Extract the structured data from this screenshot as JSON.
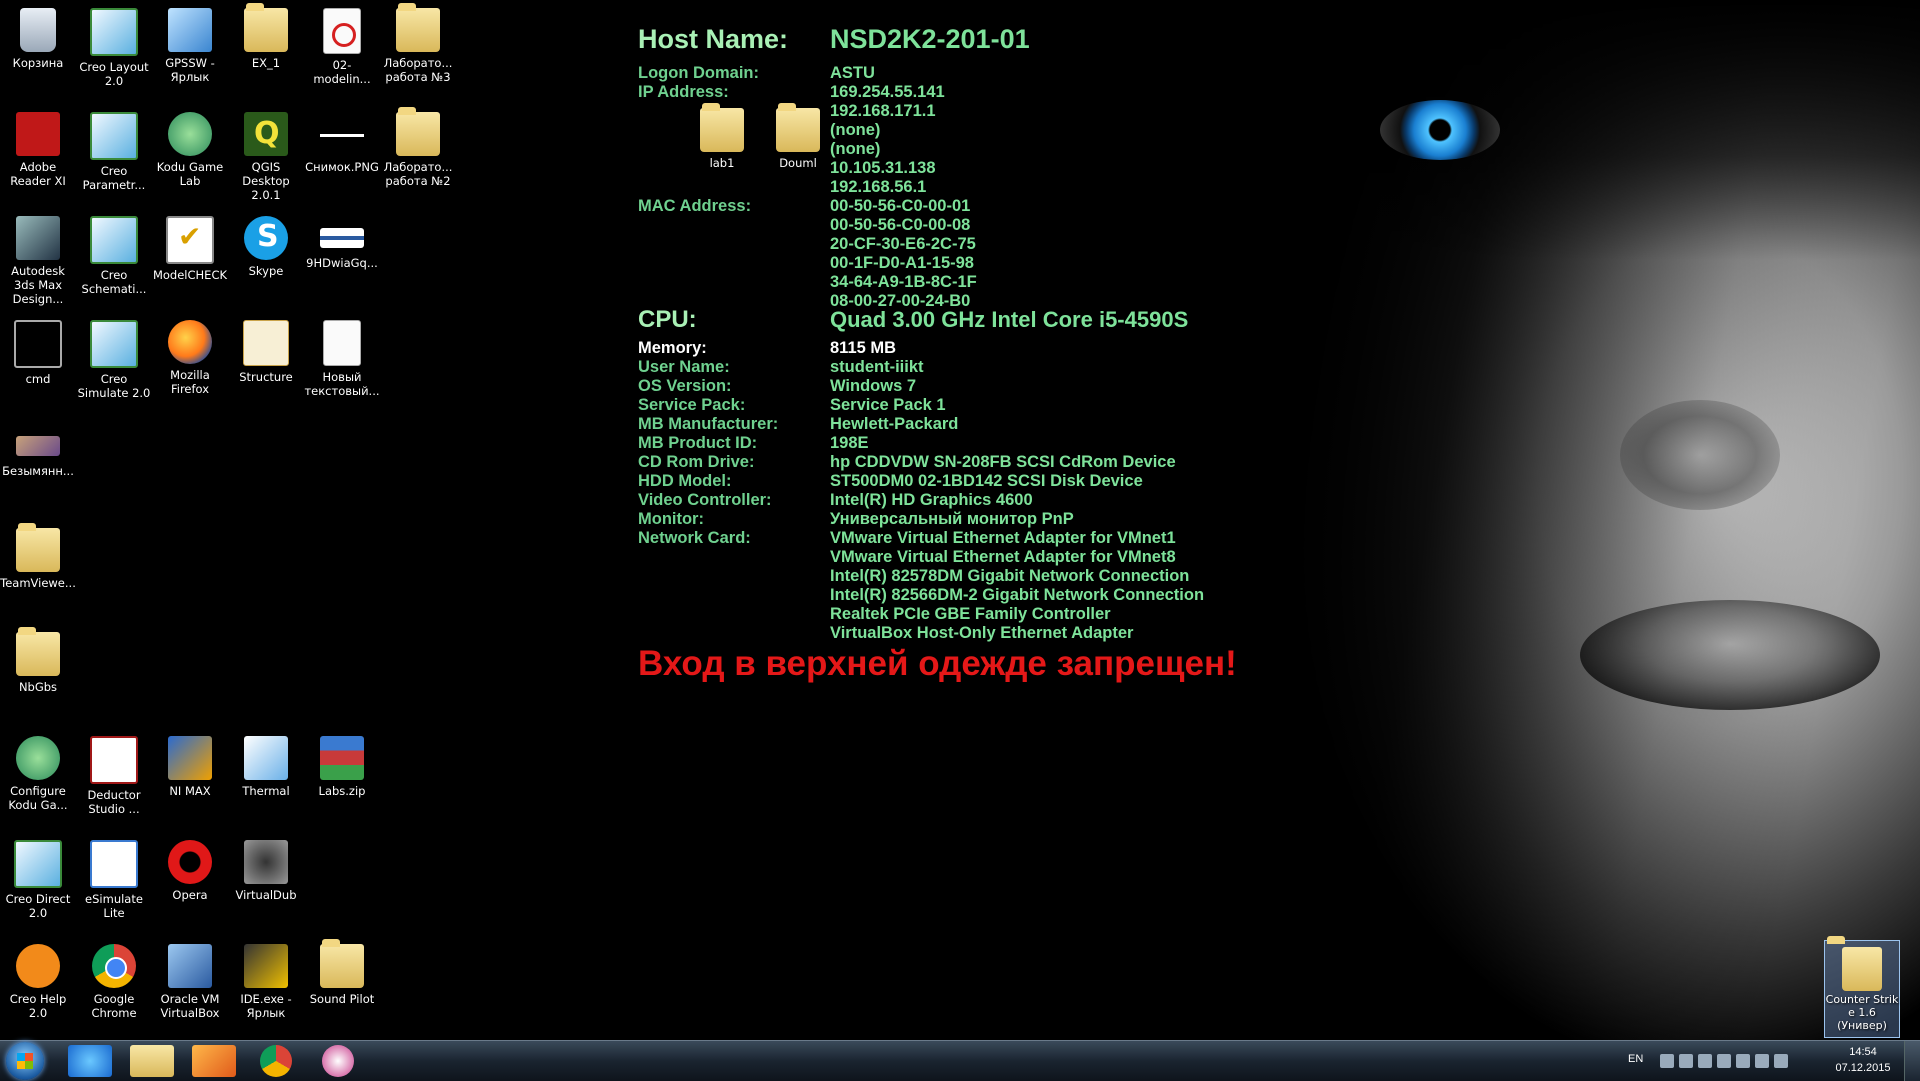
{
  "desktop": {
    "icons": [
      {
        "label": "Корзина",
        "icon": "recycle-bin-icon"
      },
      {
        "label": "Creo Layout 2.0",
        "icon": "creo-layout-icon"
      },
      {
        "label": "GPSSW - Ярлык",
        "icon": "gpssw-icon"
      },
      {
        "label": "EX_1",
        "icon": "folder-icon"
      },
      {
        "label": "02-modelin...",
        "icon": "pdf-icon"
      },
      {
        "label": "Лаборато... работа №3",
        "icon": "folder-doc-icon"
      },
      {
        "label": "Adobe Reader XI",
        "icon": "adobe-reader-icon"
      },
      {
        "label": "Creo Parametr...",
        "icon": "creo-parametric-icon"
      },
      {
        "label": "Kodu Game Lab",
        "icon": "kodu-icon"
      },
      {
        "label": "QGIS Desktop 2.0.1",
        "icon": "qgis-icon"
      },
      {
        "label": "Снимок.PNG",
        "icon": "png-image-icon"
      },
      {
        "label": "Лаборато... работа №2",
        "icon": "folder-doc-icon"
      },
      {
        "label": "Autodesk 3ds Max Design...",
        "icon": "3ds-max-icon"
      },
      {
        "label": "Creo Schemati...",
        "icon": "creo-schematics-icon"
      },
      {
        "label": "ModelCHECK",
        "icon": "modelcheck-icon"
      },
      {
        "label": "Skype",
        "icon": "skype-icon"
      },
      {
        "label": "9HDwiaGq...",
        "icon": "image-icon"
      },
      {
        "label": "cmd",
        "icon": "cmd-icon"
      },
      {
        "label": "Creo Simulate 2.0",
        "icon": "creo-simulate-icon"
      },
      {
        "label": "Mozilla Firefox",
        "icon": "firefox-icon"
      },
      {
        "label": "Structure",
        "icon": "structure-icon"
      },
      {
        "label": "Новый текстовый...",
        "icon": "text-file-icon"
      },
      {
        "label": "Безымянн...",
        "icon": "image-icon"
      },
      {
        "label": "TeamViewe...",
        "icon": "folder-icon"
      },
      {
        "label": "NbGbs",
        "icon": "folder-icon"
      },
      {
        "label": "Configure Kodu Ga...",
        "icon": "kodu-config-icon"
      },
      {
        "label": "Deductor Studio ...",
        "icon": "deductor-icon"
      },
      {
        "label": "NI MAX",
        "icon": "ni-max-icon"
      },
      {
        "label": "Thermal",
        "icon": "thermal-icon"
      },
      {
        "label": "Labs.zip",
        "icon": "zip-icon"
      },
      {
        "label": "Creo Direct 2.0",
        "icon": "creo-direct-icon"
      },
      {
        "label": "eSimulate Lite",
        "icon": "esimulate-icon"
      },
      {
        "label": "Opera",
        "icon": "opera-icon"
      },
      {
        "label": "VirtualDub",
        "icon": "virtualdub-icon"
      },
      {
        "label": "Creo Help 2.0",
        "icon": "creo-help-icon"
      },
      {
        "label": "Google Chrome",
        "icon": "chrome-icon"
      },
      {
        "label": "Oracle VM VirtualBox",
        "icon": "virtualbox-icon"
      },
      {
        "label": "IDE.exe - Ярлык",
        "icon": "ide-icon"
      },
      {
        "label": "Sound Pilot",
        "icon": "folder-icon"
      },
      {
        "label": "lab1",
        "icon": "folder-icon"
      },
      {
        "label": "Douml",
        "icon": "folder-icon"
      }
    ],
    "counter_strike": {
      "label": "Counter Strik e 1.6 (Универ)",
      "icon": "folder-icon"
    }
  },
  "sysinfo": {
    "host_label": "Host Name:",
    "host_value": "NSD2K2-201-01",
    "domain_label": "Logon Domain:",
    "domain_value": "ASTU",
    "ip_label": "IP Address:",
    "ip_values": [
      "169.254.55.141",
      "192.168.171.1",
      "(none)",
      "(none)",
      "10.105.31.138",
      "192.168.56.1"
    ],
    "mac_label": "MAC Address:",
    "mac_values": [
      "00-50-56-C0-00-01",
      "00-50-56-C0-00-08",
      "20-CF-30-E6-2C-75",
      "00-1F-D0-A1-15-98",
      "34-64-A9-1B-8C-1F",
      "08-00-27-00-24-B0"
    ],
    "cpu_label": "CPU:",
    "cpu_value": "Quad 3.00 GHz Intel Core i5-4590S",
    "memory_label": "Memory:",
    "memory_value": "8115 MB",
    "user_label": "User Name:",
    "user_value": "student-iiikt",
    "os_label": "OS Version:",
    "os_value": "Windows 7",
    "sp_label": "Service Pack:",
    "sp_value": "Service Pack 1",
    "mbman_label": "MB Manufacturer:",
    "mbman_value": "Hewlett-Packard",
    "mbprod_label": "MB Product ID:",
    "mbprod_value": "198E",
    "cd_label": "CD Rom Drive:",
    "cd_value": "hp CDDVDW SN-208FB SCSI CdRom Device",
    "hdd_label": "HDD Model:",
    "hdd_value": "ST500DM0 02-1BD142 SCSI Disk Device",
    "video_label": "Video Controller:",
    "video_value": "Intel(R) HD Graphics 4600",
    "monitor_label": "Monitor:",
    "monitor_value": "Универсальный монитор PnP",
    "net_label": "Network Card:",
    "net_values": [
      "VMware Virtual Ethernet Adapter for VMnet1",
      "VMware Virtual Ethernet Adapter for VMnet8",
      "Intel(R) 82578DM Gigabit Network Connection",
      "Intel(R) 82566DM-2 Gigabit Network Connection",
      "Realtek PCIe GBE Family Controller",
      "VirtualBox Host-Only Ethernet Adapter"
    ]
  },
  "warning": "Вход в верхней одежде запрещен!",
  "taskbar": {
    "lang": "EN",
    "time": "14:54",
    "date": "07.12.2015"
  },
  "colors": {
    "sysinfo_text": "#6fd18f",
    "warning_text": "#e41818"
  }
}
